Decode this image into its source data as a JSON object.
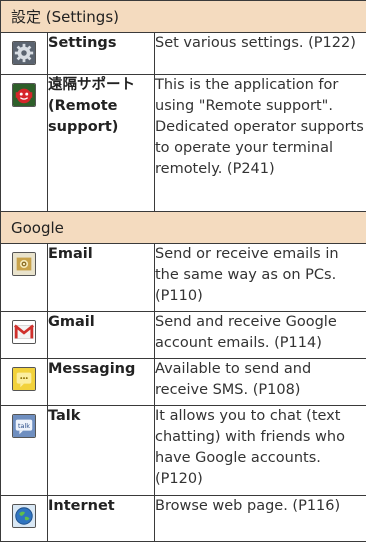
{
  "sections": [
    {
      "title": "設定 (Settings)",
      "rows": [
        {
          "icon": "gear-icon",
          "name": "Settings",
          "desc": "Set various settings. (P122)"
        },
        {
          "icon": "remote-support-icon",
          "name": "遠隔サポート (Remote support)",
          "desc": "This is the application for using \"Remote support\". Dedicated operator supports to operate your terminal remotely. (P241)"
        }
      ]
    },
    {
      "title": "Google",
      "rows": [
        {
          "icon": "email-icon",
          "name": "Email",
          "desc": "Send or receive emails in the same way as on PCs. (P110)"
        },
        {
          "icon": "gmail-icon",
          "name": "Gmail",
          "desc": "Send and receive Google account emails. (P114)"
        },
        {
          "icon": "messaging-icon",
          "name": "Messaging",
          "desc": "Available to send and receive SMS. (P108)"
        },
        {
          "icon": "talk-icon",
          "name": "Talk",
          "desc": "It allows you to chat (text chatting) with friends who have Google accounts. (P120)"
        },
        {
          "icon": "globe-icon",
          "name": "Internet",
          "desc": "Browse web page. (P116)"
        }
      ]
    }
  ],
  "icon_text": {
    "talk": "talk"
  },
  "colors": {
    "section_bg": "#f4dbbf",
    "border": "#3a3a3a"
  }
}
